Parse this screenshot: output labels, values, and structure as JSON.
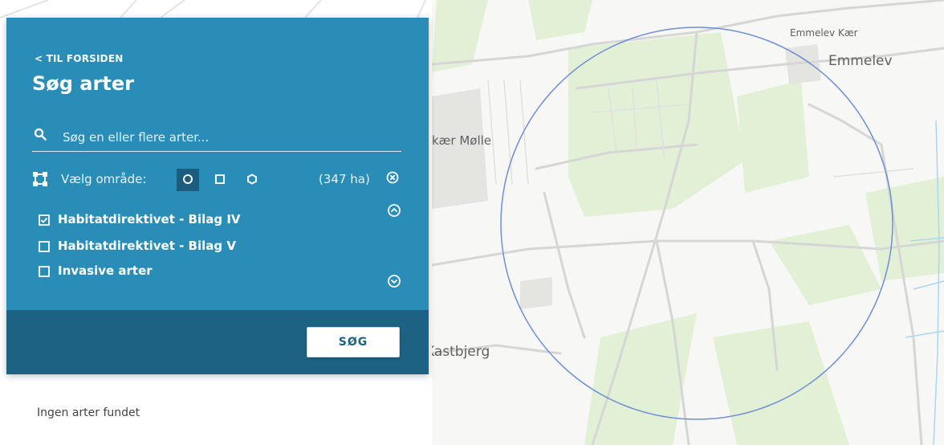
{
  "panel": {
    "back_link": "< TIL FORSIDEN",
    "title": "Søg arter",
    "search": {
      "placeholder": "Søg en eller flere arter...",
      "value": ""
    },
    "area": {
      "label": "Vælg område:",
      "shapes": [
        "circle",
        "square",
        "hexagon"
      ],
      "selected_shape": "circle",
      "size": "(347 ha)"
    },
    "filters": [
      {
        "label": "Habitatdirektivet - Bilag IV",
        "checked": true
      },
      {
        "label": "Habitatdirektivet - Bilag V",
        "checked": false
      },
      {
        "label": "Invasive arter",
        "checked": false
      }
    ],
    "search_button": "SØG",
    "colors": {
      "panel": "#2a8db8",
      "footer": "#1d6283",
      "active_shape": "#1c5c7c"
    }
  },
  "result": {
    "text": "Ingen arter fundet"
  },
  "map": {
    "labels": {
      "emmelev_kaer": "Emmelev Kær",
      "emmelev": "Emmelev",
      "kaer_molle": "kær Mølle",
      "kastbjerg": "Kastbjerg"
    },
    "colors": {
      "background": "#f7f7f5",
      "green": "#e2f0d6",
      "road": "#dcdcdc",
      "selection_circle": "#6f8fd8",
      "water": "#a9d7ef"
    }
  }
}
